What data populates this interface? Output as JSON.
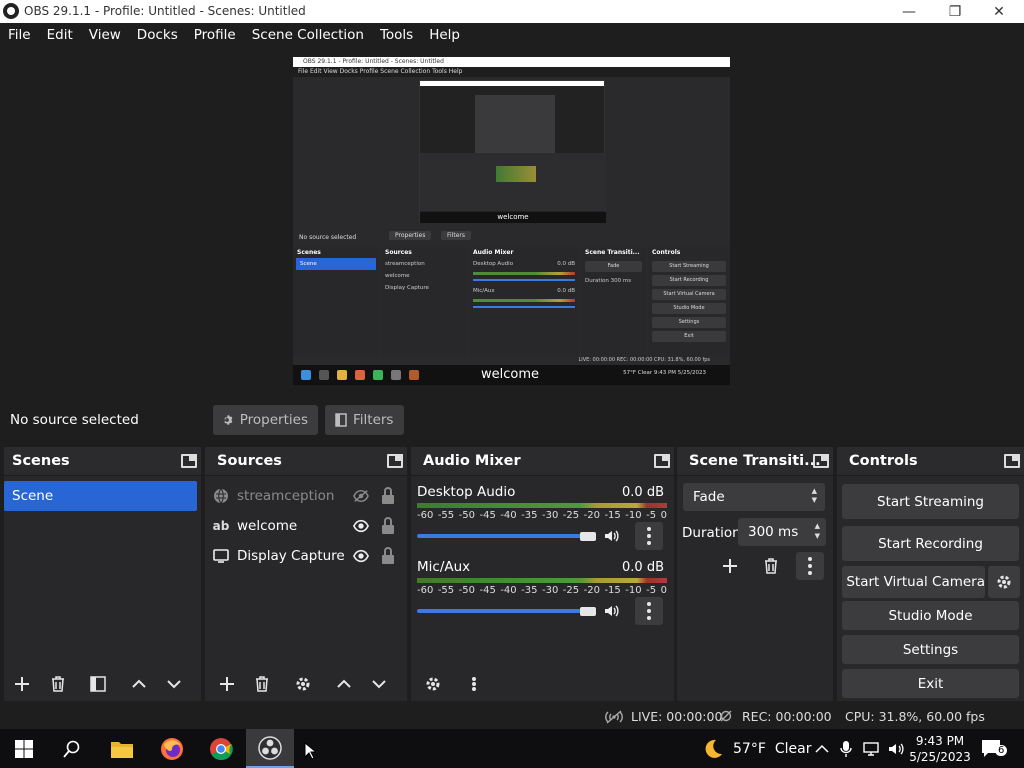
{
  "window": {
    "title": "OBS 29.1.1 - Profile: Untitled - Scenes: Untitled",
    "minimize": "—",
    "maximize": "❐",
    "close": "✕"
  },
  "menu": [
    "File",
    "Edit",
    "View",
    "Docks",
    "Profile",
    "Scene Collection",
    "Tools",
    "Help"
  ],
  "preview": {
    "title": "OBS 29.1.1 - Profile: Untitled - Scenes: Untitled",
    "menu": "File  Edit  View  Docks  Profile  Scene Collection  Tools  Help",
    "no_source": "No source selected",
    "properties": "Properties",
    "filters": "Filters",
    "docks": {
      "scenes": "Scenes",
      "sources": "Sources",
      "mixer": "Audio Mixer",
      "transitions": "Scene Transiti...",
      "controls": "Controls"
    },
    "scene_item": "Scene",
    "sources": [
      "streamception",
      "welcome",
      "Display Capture"
    ],
    "mixer": [
      "Desktop Audio",
      "Mic/Aux"
    ],
    "db": "0.0 dB",
    "fade": "Fade",
    "duration": "Duration",
    "duration_value": "300 ms",
    "controls": [
      "Start Streaming",
      "Start Recording",
      "Start Virtual Camera",
      "Studio Mode",
      "Settings",
      "Exit"
    ],
    "status": "LIVE: 00:00:00   REC: 00:00:00   CPU: 31.8%, 60.00 fps",
    "welcome": "welcome",
    "tray": "57°F  Clear   9:43 PM  5/25/2023"
  },
  "properties_bar": {
    "no_source": "No source selected",
    "properties": "Properties",
    "filters": "Filters"
  },
  "scenes": {
    "title": "Scenes",
    "items": [
      "Scene"
    ]
  },
  "sources": {
    "title": "Sources",
    "items": [
      {
        "name": "streamception",
        "visible": false,
        "locked": false
      },
      {
        "name": "welcome",
        "visible": true,
        "locked": false
      },
      {
        "name": "Display Capture",
        "visible": true,
        "locked": false
      }
    ]
  },
  "mixer": {
    "title": "Audio Mixer",
    "channels": [
      {
        "name": "Desktop Audio",
        "db": "0.0 dB"
      },
      {
        "name": "Mic/Aux",
        "db": "0.0 dB"
      }
    ],
    "ticks": [
      "-60",
      "-55",
      "-50",
      "-45",
      "-40",
      "-35",
      "-30",
      "-25",
      "-20",
      "-15",
      "-10",
      "-5",
      "0"
    ]
  },
  "transitions": {
    "title": "Scene Transiti...",
    "selected": "Fade",
    "duration_label": "Duration",
    "duration_value": "300 ms"
  },
  "controls": {
    "title": "Controls",
    "start_streaming": "Start Streaming",
    "start_recording": "Start Recording",
    "start_virtual_camera": "Start Virtual Camera",
    "studio_mode": "Studio Mode",
    "settings": "Settings",
    "exit": "Exit"
  },
  "status": {
    "live": "LIVE: 00:00:00",
    "rec": "REC: 00:00:00",
    "cpu": "CPU: 31.8%, 60.00 fps"
  },
  "taskbar": {
    "weather": "57°F",
    "weather_desc": "Clear",
    "time": "9:43 PM",
    "date": "5/25/2023",
    "notifications": "6"
  },
  "colors": {
    "accent": "#2766d4",
    "background": "#1f1e1f",
    "dock": "#28272a",
    "button": "#3c3b3d"
  }
}
